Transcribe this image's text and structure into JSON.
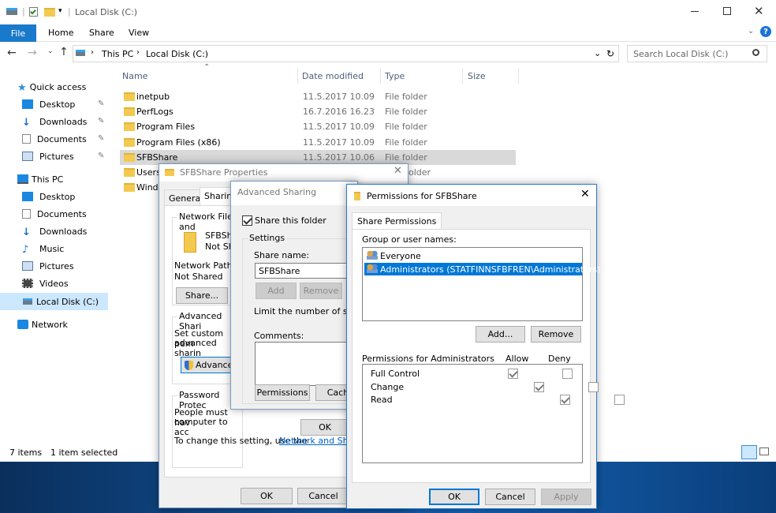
{
  "explorer": {
    "title": "Local Disk (C:)",
    "ribbon_tabs": [
      "File",
      "Home",
      "Share",
      "View"
    ],
    "address": {
      "this_pc": "This PC",
      "drive": "Local Disk (C:)"
    },
    "search_placeholder": "Search Local Disk (C:)",
    "columns": {
      "name": "Name",
      "date": "Date modified",
      "type": "Type",
      "size": "Size"
    },
    "files": [
      {
        "name": "inetpub",
        "date": "11.5.2017 10.09",
        "type": "File folder"
      },
      {
        "name": "PerfLogs",
        "date": "16.7.2016 16.23",
        "type": "File folder"
      },
      {
        "name": "Program Files",
        "date": "11.5.2017 10.09",
        "type": "File folder"
      },
      {
        "name": "Program Files (x86)",
        "date": "11.5.2017 10.09",
        "type": "File folder"
      },
      {
        "name": "SFBShare",
        "date": "11.5.2017 10.06",
        "type": "File folder"
      },
      {
        "name": "Users",
        "date": "",
        "type": "older"
      },
      {
        "name": "Windo",
        "date": "",
        "type": ""
      }
    ],
    "nav": {
      "quick_access": "Quick access",
      "qa_items": [
        "Desktop",
        "Downloads",
        "Documents",
        "Pictures"
      ],
      "this_pc": "This PC",
      "pc_items": [
        "Desktop",
        "Documents",
        "Downloads",
        "Music",
        "Pictures",
        "Videos",
        "Local Disk (C:)"
      ],
      "network": "Network"
    },
    "status": {
      "count": "7 items",
      "selected": "1 item selected"
    }
  },
  "properties": {
    "title": "SFBShare Properties",
    "tabs": [
      "General",
      "Sharing"
    ],
    "network_group": "Network File and",
    "folder_name": "SFBSh",
    "folder_state": "Not Sh",
    "network_path_label": "Network Path:",
    "network_path_value": "Not Shared",
    "share_btn": "Share...",
    "advanced_group": "Advanced Shari",
    "advanced_text_1": "Set custom pem",
    "advanced_text_2": "advanced sharin",
    "advanced_btn": "Advance",
    "password_group": "Password Protec",
    "password_text_1": "People must hav",
    "password_text_2": "computer to acc",
    "change_text": "To change this setting, use the",
    "change_link": "Network and Sharin",
    "ok": "OK",
    "cancel": "Cancel"
  },
  "advanced": {
    "title": "Advanced Sharing",
    "share_checkbox": "Share this folder",
    "settings_group": "Settings",
    "share_name_label": "Share name:",
    "share_name_value": "SFBShare",
    "add": "Add",
    "remove": "Remove",
    "limit_text": "Limit the number of simultan",
    "comments_label": "Comments:",
    "permissions_btn": "Permissions",
    "caching_btn": "Cachi",
    "ok": "OK"
  },
  "permissions": {
    "title": "Permissions for SFBShare",
    "tab": "Share Permissions",
    "group_label": "Group or user names:",
    "users": [
      "Everyone",
      "Administrators (STATFINNSFBFREN\\Administrators)"
    ],
    "add": "Add...",
    "remove": "Remove",
    "perm_header": "Permissions for Administrators",
    "allow": "Allow",
    "deny": "Deny",
    "perms": [
      {
        "name": "Full Control",
        "allow": true,
        "deny": false
      },
      {
        "name": "Change",
        "allow": true,
        "deny": false
      },
      {
        "name": "Read",
        "allow": true,
        "deny": false
      }
    ],
    "ok": "OK",
    "cancel": "Cancel",
    "apply": "Apply"
  }
}
